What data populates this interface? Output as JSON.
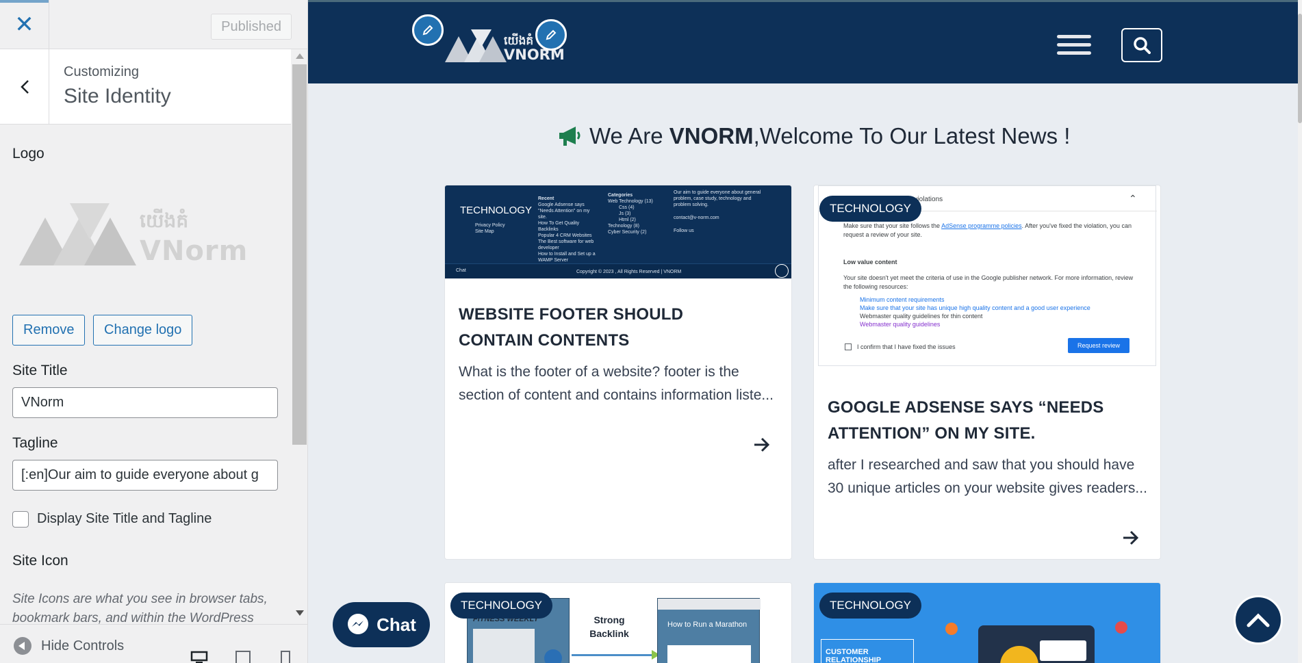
{
  "panel": {
    "published_label": "Published",
    "crumb": "Customizing",
    "section_title": "Site Identity",
    "logo_label": "Logo",
    "logo_text_khmer": "យើងគំ",
    "logo_text_latin": "VNorm",
    "remove_label": "Remove",
    "change_logo_label": "Change logo",
    "site_title_label": "Site Title",
    "site_title_value": "VNorm",
    "tagline_label": "Tagline",
    "tagline_value": "[:en]Our aim to guide everyone about g",
    "display_checkbox_label": "Display Site Title and Tagline",
    "display_checked": false,
    "site_icon_label": "Site Icon",
    "site_icon_desc": "Site Icons are what you see in browser tabs, bookmark bars, and within the WordPress",
    "hide_controls_label": "Hide Controls"
  },
  "preview": {
    "header_logo_khmer": "យើងគំ",
    "header_logo_latin": "VNORM",
    "welcome_prefix": "We Are ",
    "welcome_brand": "VNORM",
    "welcome_suffix": ",Welcome To Our Latest News !",
    "cards": [
      {
        "tag": "",
        "title": "WEBSITE FOOTER SHOULD CONTAIN CONTENTS",
        "excerpt": "What is the footer of a website? footer is the section of content and contains information liste..."
      },
      {
        "tag": "TECHNOLOGY",
        "title": "GOOGLE ADSENSE SAYS “NEEDS ATTENTION” ON MY SITE.",
        "excerpt": "after I researched and saw that you should have 30 unique articles on your website gives readers..."
      },
      {
        "tag": "TECHNOLOGY"
      },
      {
        "tag": "TECHNOLOGY"
      }
    ],
    "thumb_footer": {
      "brand": "TECHNOLOGY",
      "links": [
        "Privacy Policy",
        "Site Map"
      ],
      "recent_title": "Recent",
      "recent": [
        "Google Adsense says \"Needs Attention\" on my site.",
        "How To Get Quality Backlinks",
        "Popular 4 CRM Websites",
        "The Best software for web developer",
        "How to Install and Set up a WAMP Server"
      ],
      "categories_title": "Categories",
      "categories": [
        "Web Technology (13)",
        "Css (4)",
        "Js (3)",
        "Html (2)",
        "Technology (8)",
        "Cyber Security (2)"
      ],
      "about": "Our aim to guide everyone about general problem, case study, technology and problem solving.",
      "email": "contact@v-norm.com",
      "follow": "Follow us",
      "copyright": "Copyright © 2023 , All Rights Reserved | VNORM",
      "chat": "Chat"
    },
    "thumb_adsense": {
      "heading": "Policy violations",
      "line1a": "Make sure that your site follows the ",
      "line1link": "AdSense programme policies",
      "line1b": ". After you've fixed the violation, you can request a review of your site.",
      "low_title": "Low value content",
      "low_text": "Your site doesn't yet meet the criteria of use in the Google publisher network. For more information, review the following resources:",
      "bullets": [
        "Minimum content requirements",
        "Make sure that your site has unique high quality content and a good user experience",
        "Webmaster quality guidelines for thin content",
        "Webmaster quality guidelines"
      ],
      "confirm": "I confirm that I have fixed the issues",
      "request": "Request review"
    },
    "thumb_backlink": {
      "fitness": "FITNESS WEEKLY",
      "strong": "Strong Backlink",
      "marathon": "How to Run a Marathon"
    },
    "thumb_crm": {
      "crm": "CUSTOMER RELATIONSHIP MANAGEMENT"
    },
    "chat_label": "Chat"
  }
}
